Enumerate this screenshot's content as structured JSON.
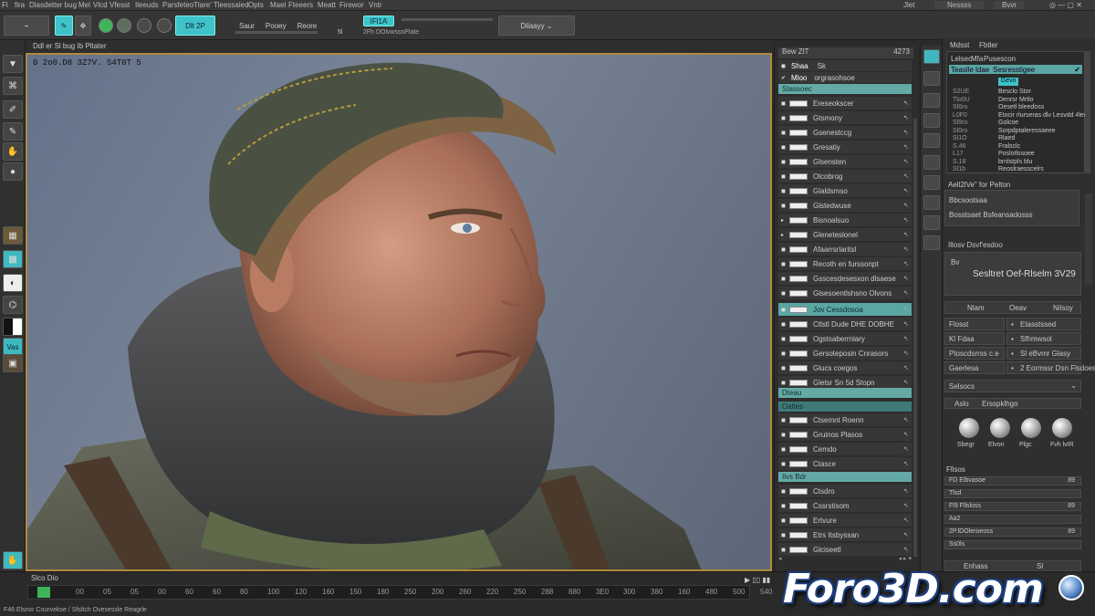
{
  "menubar": {
    "items": [
      "Fl",
      "fira",
      "Dlasdetter bug",
      "Mel",
      "Vlcd",
      "Vfesst",
      "Ileeuds",
      "Parsfeteo",
      "Tlare' Tleessaled",
      "Opts",
      "Mael",
      "Fteeers",
      "Meatt",
      "Firewor",
      "Vntr"
    ],
    "right": [
      "Jlet",
      "Nessss",
      "Bvvr"
    ]
  },
  "toolbar": {
    "btn1": "Kiltc",
    "btn2": "Dlt",
    "btn3": "2P",
    "labels": [
      "Saur",
      "Pooey",
      "Reore"
    ],
    "highlight": "IFl1A",
    "sub": "2Fh DOlvwsssPlate",
    "dropdown": "Dilaayy",
    "sub2": "5l"
  },
  "infobar": "Ddl er Sl bug Ib Pltater",
  "viewport": {
    "coords": "0 2o0.D8 3Z7V. S4T0T 5",
    "accent": "#b08a3e"
  },
  "midpanel": {
    "header": [
      "Bew ZlT",
      "4273"
    ],
    "top": [
      "Shaa",
      "Mloo"
    ],
    "top2": [
      "Sk",
      "orgrasohsoe"
    ],
    "sectionA": "Stassoec",
    "rowsA": [
      "Ereseokscer",
      "Gtsmony",
      "Gsenestccg",
      "Gresatiy",
      "Glsensten",
      "Olcobrog",
      "Glaldsmso",
      "Glstedwuse",
      "Bisnoalsuo",
      "Gleneteslonel",
      "Afaarrsrlaritsl",
      "Recoth en furssonpt",
      "Gsscesdesesxon dlsaese",
      "Glsesoentlshsno Olvons",
      "Jov Cessdosoa",
      "Ctlstl Dude DHE DOBHE",
      "Ogstsaberrniary",
      "Gersoteposin Cnrasors",
      "Glucs coegos",
      "Gletsr Sn 5d Stopn"
    ],
    "sectionB": "Dteau",
    "sectionC": "Oatles",
    "rowsC": [
      "Ctsemnt Roenn",
      "Gruinos Plasos",
      "Cemdo",
      "Ctasce"
    ],
    "sectionD": "Ilvs Bdr",
    "rowsD": [
      "Ctsdro",
      "Cssrstisom",
      "Ertvure",
      "Etrs Itsbyssan",
      "Glciseetl"
    ]
  },
  "rightpanel": {
    "tabs": [
      "Mdsst",
      "Fbtler"
    ],
    "list_header": [
      "Lelsec",
      "Mfa",
      "Pusescon"
    ],
    "list_sel": [
      "Teaslle ldae",
      "Sesresstigee"
    ],
    "list_cyan": "Gevo",
    "list_left": [
      "S2UE",
      "Tlo0U",
      "Sl6ro",
      "L0F0",
      "Sl9ro",
      "Sl0ro",
      "Sl1O",
      "S.46",
      "L17",
      "S.18",
      "Sl1b"
    ],
    "list_right": [
      "Besclo Stor",
      "Denrsr Mrtlo",
      "Oesetl bleedoss",
      "Etocir rlurseras dlv Lesvdd 4leca",
      "Golcoe",
      "Sorpdptaleressaeee",
      "Rlaed",
      "Fralsclc",
      "Poslotlssoee",
      "brnlstpls blu",
      "Reoslraesscelrs"
    ],
    "section1": "Aell2lVe\" for Pelton",
    "s1_rows": [
      "Bbcsootsaa",
      "Bosstsaet Bsfeansadosss"
    ],
    "section2": "Illosv Dsvf'esdoo",
    "preview_label": "Bv",
    "preview_text": "Sesltret Oef-Rlselm 3V29",
    "table_headers": [
      "Nlam",
      "Oeav",
      "Nilsoy"
    ],
    "table_rows": [
      [
        "Flosst",
        "",
        "Etasstssed"
      ],
      [
        "Kl Fdaa",
        "",
        "Sfhmwsol"
      ],
      [
        "Ptoscdsrrss c.e",
        "",
        "Sl eBvmr Glasy"
      ],
      [
        "Gaerlesa",
        "",
        "2 Eormssr Dsn Flsdoes"
      ]
    ],
    "section3": "Selsocs",
    "dropdown": [
      "Aslo",
      "Ersspklhgo"
    ],
    "materials": [
      "Sbegr",
      "Elvon",
      "Plgc",
      "Fvh lvIR"
    ],
    "section4": "Fllsos",
    "sliders": [
      [
        "FD Elbvasoe",
        "89"
      ],
      [
        "Tlsd",
        ""
      ],
      [
        "Fl9 Fllsloss",
        "89"
      ],
      [
        "Aa2",
        ""
      ],
      [
        "2P.lDOleroeoss",
        "89"
      ],
      [
        "Ss0ls",
        ""
      ]
    ],
    "bottom": [
      "Enhass",
      "Dlensmr",
      "Sl"
    ]
  },
  "lefttools": {
    "cyan_label": "Vas"
  },
  "timeline": {
    "title": "Slco Dio",
    "ticks": [
      "00",
      "05",
      "05",
      "00",
      "60",
      "60",
      "80",
      "100",
      "120",
      "160",
      "150",
      "180",
      "250",
      "200",
      "260",
      "220",
      "250",
      "288",
      "880",
      "3E0",
      "300",
      "380",
      "160",
      "480",
      "500",
      "540"
    ],
    "status": "F46 Elsnvr Courvekse / Sfsltch Ovesessle Reagrle"
  },
  "watermark": "Foro3D.com"
}
